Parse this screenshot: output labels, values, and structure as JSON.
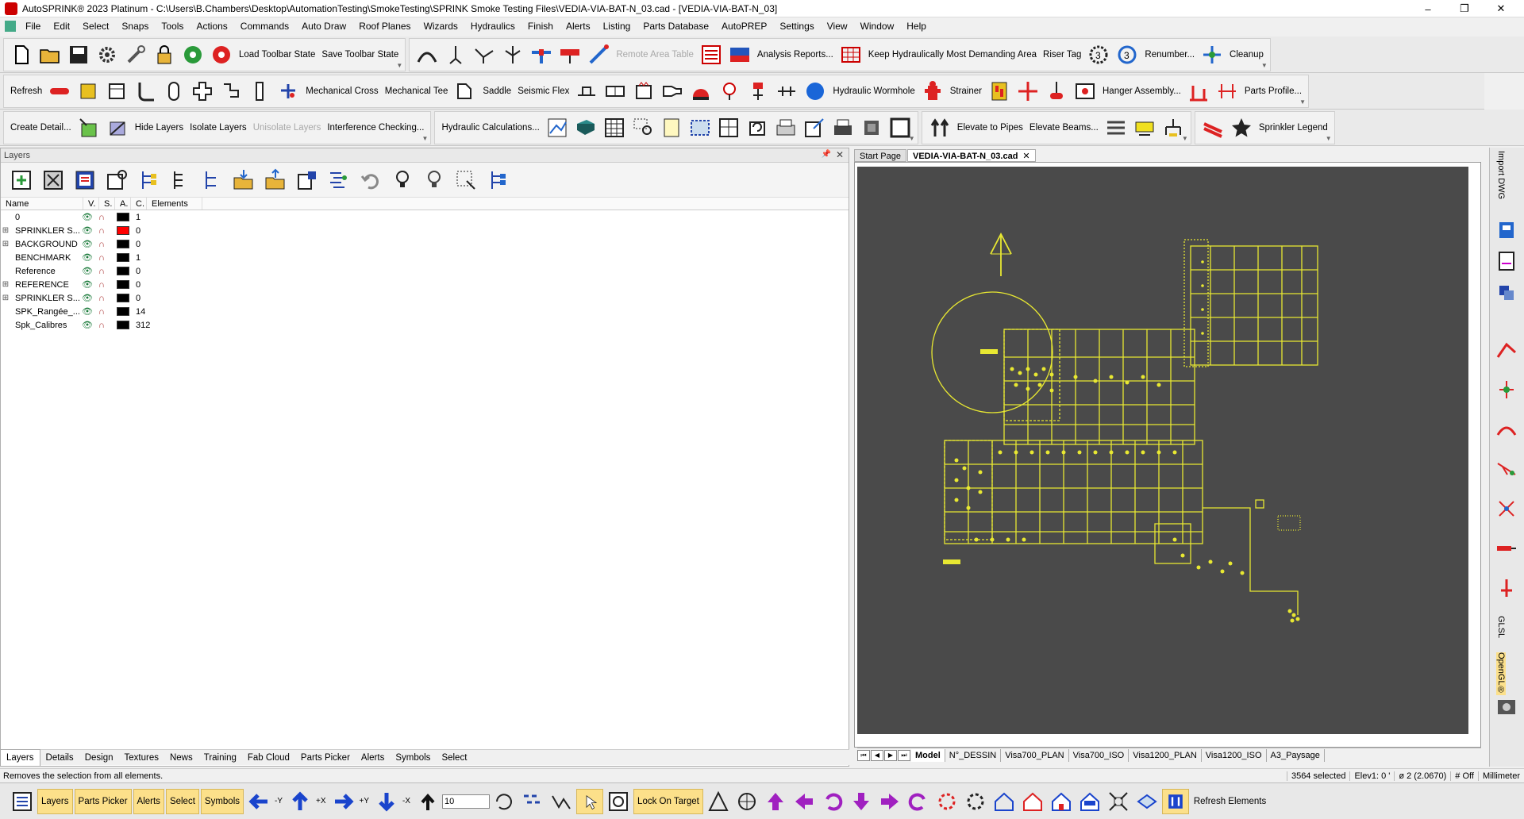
{
  "window": {
    "title": "AutoSPRINK® 2023 Platinum - C:\\Users\\B.Chambers\\Desktop\\AutomationTesting\\SmokeTesting\\SPRINK Smoke Testing Files\\VEDIA-VIA-BAT-N_03.cad - [VEDIA-VIA-BAT-N_03]",
    "controls": [
      "–",
      "❐",
      "✕"
    ]
  },
  "menu": [
    "File",
    "Edit",
    "Select",
    "Snaps",
    "Tools",
    "Actions",
    "Commands",
    "Auto Draw",
    "Roof Planes",
    "Wizards",
    "Hydraulics",
    "Finish",
    "Alerts",
    "Listing",
    "Parts Database",
    "AutoPREP",
    "Settings",
    "View",
    "Window",
    "Help"
  ],
  "toolbar1": {
    "load_state": "Load Toolbar State",
    "save_state": "Save Toolbar State",
    "remote_area": "Remote Area Table",
    "analysis": "Analysis Reports...",
    "keep_hydraulic": "Keep Hydraulically Most Demanding Area",
    "riser_tag": "Riser Tag",
    "renumber": "Renumber...",
    "cleanup": "Cleanup"
  },
  "toolbar2": {
    "refresh": "Refresh",
    "mech_cross": "Mechanical Cross",
    "mech_tee": "Mechanical Tee",
    "saddle": "Saddle",
    "seismic_flex": "Seismic Flex",
    "hydraulic_wormhole": "Hydraulic Wormhole",
    "strainer": "Strainer",
    "hanger_assembly": "Hanger Assembly...",
    "parts_profile": "Parts Profile..."
  },
  "toolbar3": {
    "create_detail": "Create Detail...",
    "hide_layers": "Hide Layers",
    "isolate_layers": "Isolate Layers",
    "unisolate_layers": "Unisolate Layers",
    "interference": "Interference Checking...",
    "hydraulic_calcs": "Hydraulic Calculations...",
    "elevate_pipes": "Elevate to Pipes",
    "elevate_beams": "Elevate Beams...",
    "sprinkler_legend": "Sprinkler Legend"
  },
  "layers_panel": {
    "title": "Layers",
    "columns": [
      "Name",
      "V.",
      "S.",
      "A.",
      "C.",
      "Elements"
    ],
    "rows": [
      {
        "name": "0",
        "expandable": false,
        "color": "#000000",
        "elements": "1"
      },
      {
        "name": "SPRINKLER S...",
        "expandable": true,
        "color": "#ff0000",
        "elements": "0"
      },
      {
        "name": "BACKGROUND",
        "expandable": true,
        "color": "#000000",
        "elements": "0"
      },
      {
        "name": "BENCHMARK",
        "expandable": false,
        "color": "#000000",
        "elements": "1"
      },
      {
        "name": "Reference",
        "expandable": false,
        "color": "#000000",
        "elements": "0"
      },
      {
        "name": "REFERENCE",
        "expandable": true,
        "color": "#000000",
        "elements": "0"
      },
      {
        "name": "SPRINKLER S...",
        "expandable": true,
        "color": "#000000",
        "elements": "0"
      },
      {
        "name": "SPK_Rangée_...",
        "expandable": false,
        "color": "#000000",
        "elements": "14"
      },
      {
        "name": "Spk_Calibres",
        "expandable": false,
        "color": "#000000",
        "elements": "312"
      }
    ]
  },
  "bottom_tabs": [
    "Layers",
    "Details",
    "Design",
    "Textures",
    "News",
    "Training",
    "Fab Cloud",
    "Parts Picker",
    "Alerts",
    "Symbols",
    "Select"
  ],
  "doc_tabs": {
    "start": "Start Page",
    "active": "VEDIA-VIA-BAT-N_03.cad"
  },
  "layout_tabs": [
    "Model",
    "N°_DESSIN",
    "Visa700_PLAN",
    "Visa700_ISO",
    "Visa1200_PLAN",
    "Visa1200_ISO",
    "A3_Paysage"
  ],
  "status": {
    "message": "Removes the selection from all elements.",
    "selected": "3564 selected",
    "elev": "Elev1: 0 '",
    "diameter": "ø 2 (2.0670)",
    "off": "# Off",
    "units": "Millimeter"
  },
  "bottom_bar": {
    "layers": "Layers",
    "parts_picker": "Parts Picker",
    "alerts": "Alerts",
    "select": "Select",
    "symbols": "Symbols",
    "axis": [
      "-Y",
      "+X",
      "+Y",
      "-X"
    ],
    "input_value": "10",
    "lock_on_target": "Lock On Target",
    "refresh_elements": "Refresh Elements"
  },
  "right_dock": {
    "import_dwg": "Import DWG",
    "glsl": "GLSL",
    "opengl": "OpenGL®"
  },
  "colors": {
    "drawing": "#e8e832",
    "viewport_bg": "#4a4a4a",
    "highlight": "#fce08a"
  }
}
